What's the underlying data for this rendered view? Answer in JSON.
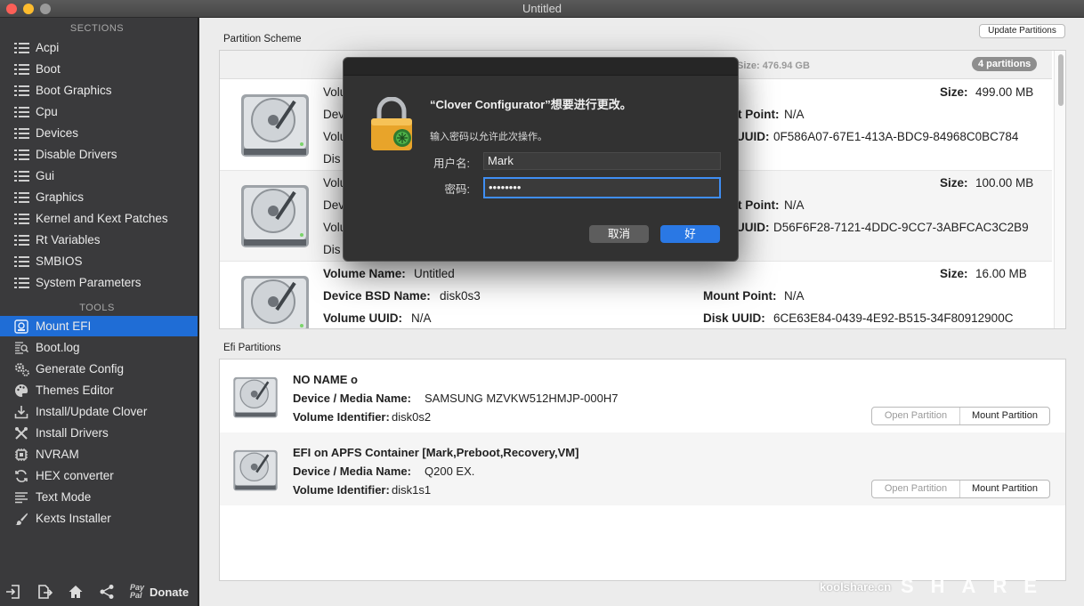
{
  "window": {
    "title": "Untitled"
  },
  "sidebar": {
    "sections_header": "SECTIONS",
    "tools_header": "TOOLS",
    "sections": [
      {
        "label": "Acpi",
        "icon": "list-icon"
      },
      {
        "label": "Boot",
        "icon": "list-icon"
      },
      {
        "label": "Boot Graphics",
        "icon": "list-icon"
      },
      {
        "label": "Cpu",
        "icon": "list-icon"
      },
      {
        "label": "Devices",
        "icon": "list-icon"
      },
      {
        "label": "Disable Drivers",
        "icon": "list-icon"
      },
      {
        "label": "Gui",
        "icon": "list-icon"
      },
      {
        "label": "Graphics",
        "icon": "list-icon"
      },
      {
        "label": "Kernel and Kext Patches",
        "icon": "list-icon"
      },
      {
        "label": "Rt Variables",
        "icon": "list-icon"
      },
      {
        "label": "SMBIOS",
        "icon": "list-icon"
      },
      {
        "label": "System Parameters",
        "icon": "list-icon"
      }
    ],
    "tools": [
      {
        "label": "Mount EFI",
        "icon": "mount-efi-icon",
        "selected": true
      },
      {
        "label": "Boot.log",
        "icon": "log-search-icon"
      },
      {
        "label": "Generate Config",
        "icon": "gears-icon"
      },
      {
        "label": "Themes Editor",
        "icon": "palette-icon"
      },
      {
        "label": "Install/Update Clover",
        "icon": "download-icon"
      },
      {
        "label": "Install Drivers",
        "icon": "tools-icon"
      },
      {
        "label": "NVRAM",
        "icon": "chip-icon"
      },
      {
        "label": "HEX converter",
        "icon": "convert-icon"
      },
      {
        "label": "Text Mode",
        "icon": "text-lines-icon"
      },
      {
        "label": "Kexts Installer",
        "icon": "brush-icon"
      }
    ],
    "bottom": {
      "paypal_mark": "Pay Pal",
      "donate_label": "Donate"
    }
  },
  "main": {
    "partition_scheme_label": "Partition Scheme",
    "update_button_label": "Update Partitions",
    "disk_size_label": "Size: 476.94 GB",
    "partition_count_badge": "4 partitions",
    "partitions": [
      {
        "volume_name_label": "Volu",
        "device_label": "Dev",
        "volume_uuid_label": "Volu",
        "disk_label": "Dis",
        "size_label": "Size:",
        "size_value": "499.00 MB",
        "mount_point_label": "t Point:",
        "mount_point_value": "N/A",
        "disk_uuid_label": "UUID:",
        "disk_uuid_value": "0F586A07-67E1-413A-BDC9-84968C0BC784"
      },
      {
        "volume_name_label": "Volu",
        "device_label": "Dev",
        "volume_uuid_label": "Volu",
        "disk_label": "Dis",
        "size_label": "Size:",
        "size_value": "100.00 MB",
        "mount_point_label": "t Point:",
        "mount_point_value": "N/A",
        "disk_uuid_label": "UUID:",
        "disk_uuid_value": "D56F6F28-7121-4DDC-9CC7-3ABFCAC3C2B9"
      },
      {
        "volume_name_label": "Volume Name:",
        "volume_name_value": "Untitled",
        "device_label": "Device BSD Name:",
        "device_value": "disk0s3",
        "volume_uuid_label": "Volume UUID:",
        "volume_uuid_value": "N/A",
        "size_label": "Size:",
        "size_value": "16.00 MB",
        "mount_point_label": "Mount Point:",
        "mount_point_value": "N/A",
        "disk_uuid_label": "Disk UUID:",
        "disk_uuid_value": "6CE63E84-0439-4E92-B515-34F80912900C"
      }
    ],
    "efi_label": "Efi Partitions",
    "efi_partitions": [
      {
        "name": "NO NAME o",
        "media_label": "Device / Media Name:",
        "media_value": "SAMSUNG MZVKW512HMJP-000H7",
        "identifier_label": "Volume Identifier:",
        "identifier_value": "disk0s2",
        "open_label": "Open Partition",
        "mount_label": "Mount Partition"
      },
      {
        "name": "EFI on APFS Container [Mark,Preboot,Recovery,VM]",
        "media_label": "Device / Media Name:",
        "media_value": "Q200 EX.",
        "identifier_label": "Volume Identifier:",
        "identifier_value": "disk1s1",
        "open_label": "Open Partition",
        "mount_label": "Mount Partition"
      }
    ]
  },
  "dialog": {
    "title": "“Clover Configurator”想要进行更改。",
    "message": "输入密码以允许此次操作。",
    "username_label": "用户名:",
    "username_value": "Mark",
    "password_label": "密码:",
    "password_value": "••••••••",
    "cancel_label": "取消",
    "ok_label": "好"
  },
  "watermark": {
    "site": "koolshare.cn",
    "logo_top": "KOOL",
    "logo_bottom": "SHARE"
  },
  "colors": {
    "accent": "#1f6dd6",
    "sidebar_bg": "#3a3a3c",
    "dialog_bg": "#323232",
    "dialog_ok": "#2a78e4"
  }
}
